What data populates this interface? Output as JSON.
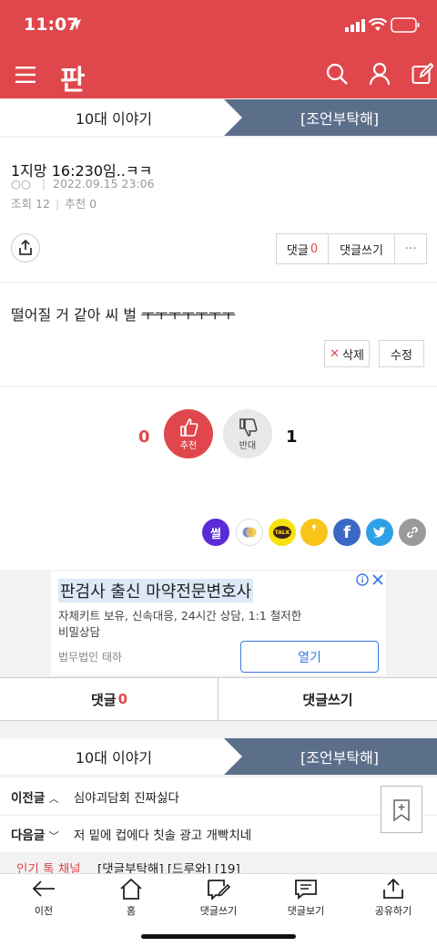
{
  "status": {
    "time": "11:07"
  },
  "header": {
    "logo": "판"
  },
  "breadcrumb": {
    "left": "10대 이야기",
    "right": "[조언부탁해]"
  },
  "post": {
    "title": "1지망 16:230임..ㅋㅋ",
    "author": "○○",
    "datetime": "2022.09.15 23:06",
    "views_label": "조회",
    "views": "12",
    "recommend_label": "추천",
    "recommend": "0",
    "body_text": "떨어질 거 같아 씨 벌 ",
    "body_strike": "ㅜㅜㅜㅜㅜㅜㅜ"
  },
  "actions": {
    "comment_label": "댓글",
    "comment_count": "0",
    "write_comment": "댓글쓰기",
    "more": "···",
    "delete": "삭제",
    "edit": "수정"
  },
  "vote": {
    "up_count": "0",
    "up_label": "추천",
    "down_label": "반대",
    "down_count": "1"
  },
  "share_icons": [
    "sseol-icon",
    "circle-icon",
    "kakaotalk-icon",
    "kakaostory-icon",
    "facebook-icon",
    "twitter-icon",
    "link-icon"
  ],
  "share": {
    "sseol": "썰",
    "talk": "TALK"
  },
  "ad": {
    "title": "판검사 출신 마약전문변호사",
    "desc_line1": "자체키트 보유, 신속대응, 24시간 상담, 1:1 철저한",
    "desc_line2": "비밀상담",
    "advertiser": "법무법인 태하",
    "open_button": "열기"
  },
  "comment_bar": {
    "comment_label": "댓글",
    "comment_count": "0",
    "write": "댓글쓰기"
  },
  "nav": {
    "prev_label": "이전글",
    "prev_title": "심야괴담회 진짜싫다",
    "next_label": "다음글",
    "next_title": "저 밑에 컵에다 칫솔 광고 개빡치네",
    "popular_label": "인기 톡 채널",
    "popular_title": "[댓글부탁해] [드루와] [19]"
  },
  "bottom": {
    "back": "이전",
    "home": "홈",
    "write_comment": "댓글쓰기",
    "view_comments": "댓글보기",
    "share": "공유하기"
  },
  "colors": {
    "accent": "#e0474c",
    "slate": "#5c6f8a",
    "link_blue": "#3b78e7"
  }
}
